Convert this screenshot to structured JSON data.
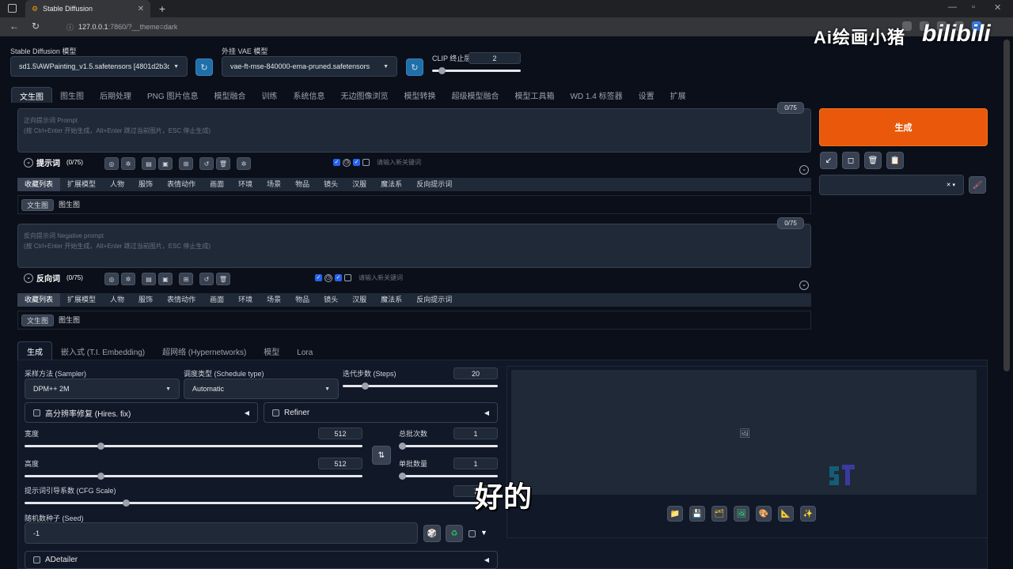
{
  "browser": {
    "tab_title": "Stable Diffusion",
    "url_host": "127.0.0.1",
    "url_rest": ":7860/?__theme=dark"
  },
  "watermark": {
    "text": "Ai绘画小猪",
    "brand": "bilibili"
  },
  "header": {
    "model_label": "Stable Diffusion 模型",
    "model_value": "sd1.5\\AWPainting_v1.5.safetensors [4801d2b3d",
    "vae_label": "外挂 VAE 模型",
    "vae_value": "vae-ft-mse-840000-ema-pruned.safetensors",
    "clip_label": "CLIP 终止层数",
    "clip_value": "2",
    "clip_level": 0.08
  },
  "main_tabs": [
    "文生图",
    "图生图",
    "后期处理",
    "PNG 图片信息",
    "模型融合",
    "训练",
    "系统信息",
    "无边图像浏览",
    "模型转换",
    "超级模型融合",
    "模型工具箱",
    "WD 1.4 标签器",
    "设置",
    "扩展"
  ],
  "prompt": {
    "counter": "0/75",
    "placeholder_1": "正向提示词 Prompt",
    "placeholder_2": "(按 Ctrl+Enter 开始生成，Alt+Enter 跳过当前图片，ESC 停止生成)",
    "section_title": "提示词",
    "section_count": "(0/75)",
    "keyword_placeholder": "请输入新关键词"
  },
  "negative": {
    "counter": "0/75",
    "placeholder_1": "反向提示词 Negative prompt",
    "placeholder_2": "(按 Ctrl+Enter 开始生成，Alt+Enter 跳过当前图片，ESC 停止生成)",
    "section_title": "反向词",
    "section_count": "(0/75)",
    "keyword_placeholder": "请输入新关键词"
  },
  "categories": [
    "收藏列表",
    "扩展模型",
    "人物",
    "服饰",
    "表情动作",
    "画面",
    "环境",
    "场景",
    "物品",
    "镜头",
    "汉服",
    "魔法系",
    "反向提示词"
  ],
  "subtabs": [
    "文生图",
    "图生图"
  ],
  "generate_label": "生成",
  "gen_tabs": [
    "生成",
    "嵌入式 (T.I. Embedding)",
    "超网络 (Hypernetworks)",
    "模型",
    "Lora"
  ],
  "settings": {
    "sampler_label": "采样方法 (Sampler)",
    "sampler_value": "DPM++ 2M",
    "schedule_label": "调度类型 (Schedule type)",
    "schedule_value": "Automatic",
    "steps_label": "迭代步数 (Steps)",
    "steps_value": "20",
    "steps_level": 0.13,
    "hires_label": "高分辨率修复 (Hires. fix)",
    "refiner_label": "Refiner",
    "width_label": "宽度",
    "width_value": "512",
    "width_level": 0.22,
    "height_label": "高度",
    "height_value": "512",
    "height_level": 0.22,
    "batch_count_label": "总批次数",
    "batch_count_value": "1",
    "batch_count_level": 0.0,
    "batch_size_label": "单批数量",
    "batch_size_value": "1",
    "batch_size_level": 0.0,
    "cfg_label": "提示词引导系数 (CFG Scale)",
    "cfg_value": "7",
    "cfg_level": 0.21,
    "seed_label": "随机数种子 (Seed)",
    "seed_value": "-1",
    "adetailer_label": "ADetailer"
  },
  "subtitle": "好的"
}
